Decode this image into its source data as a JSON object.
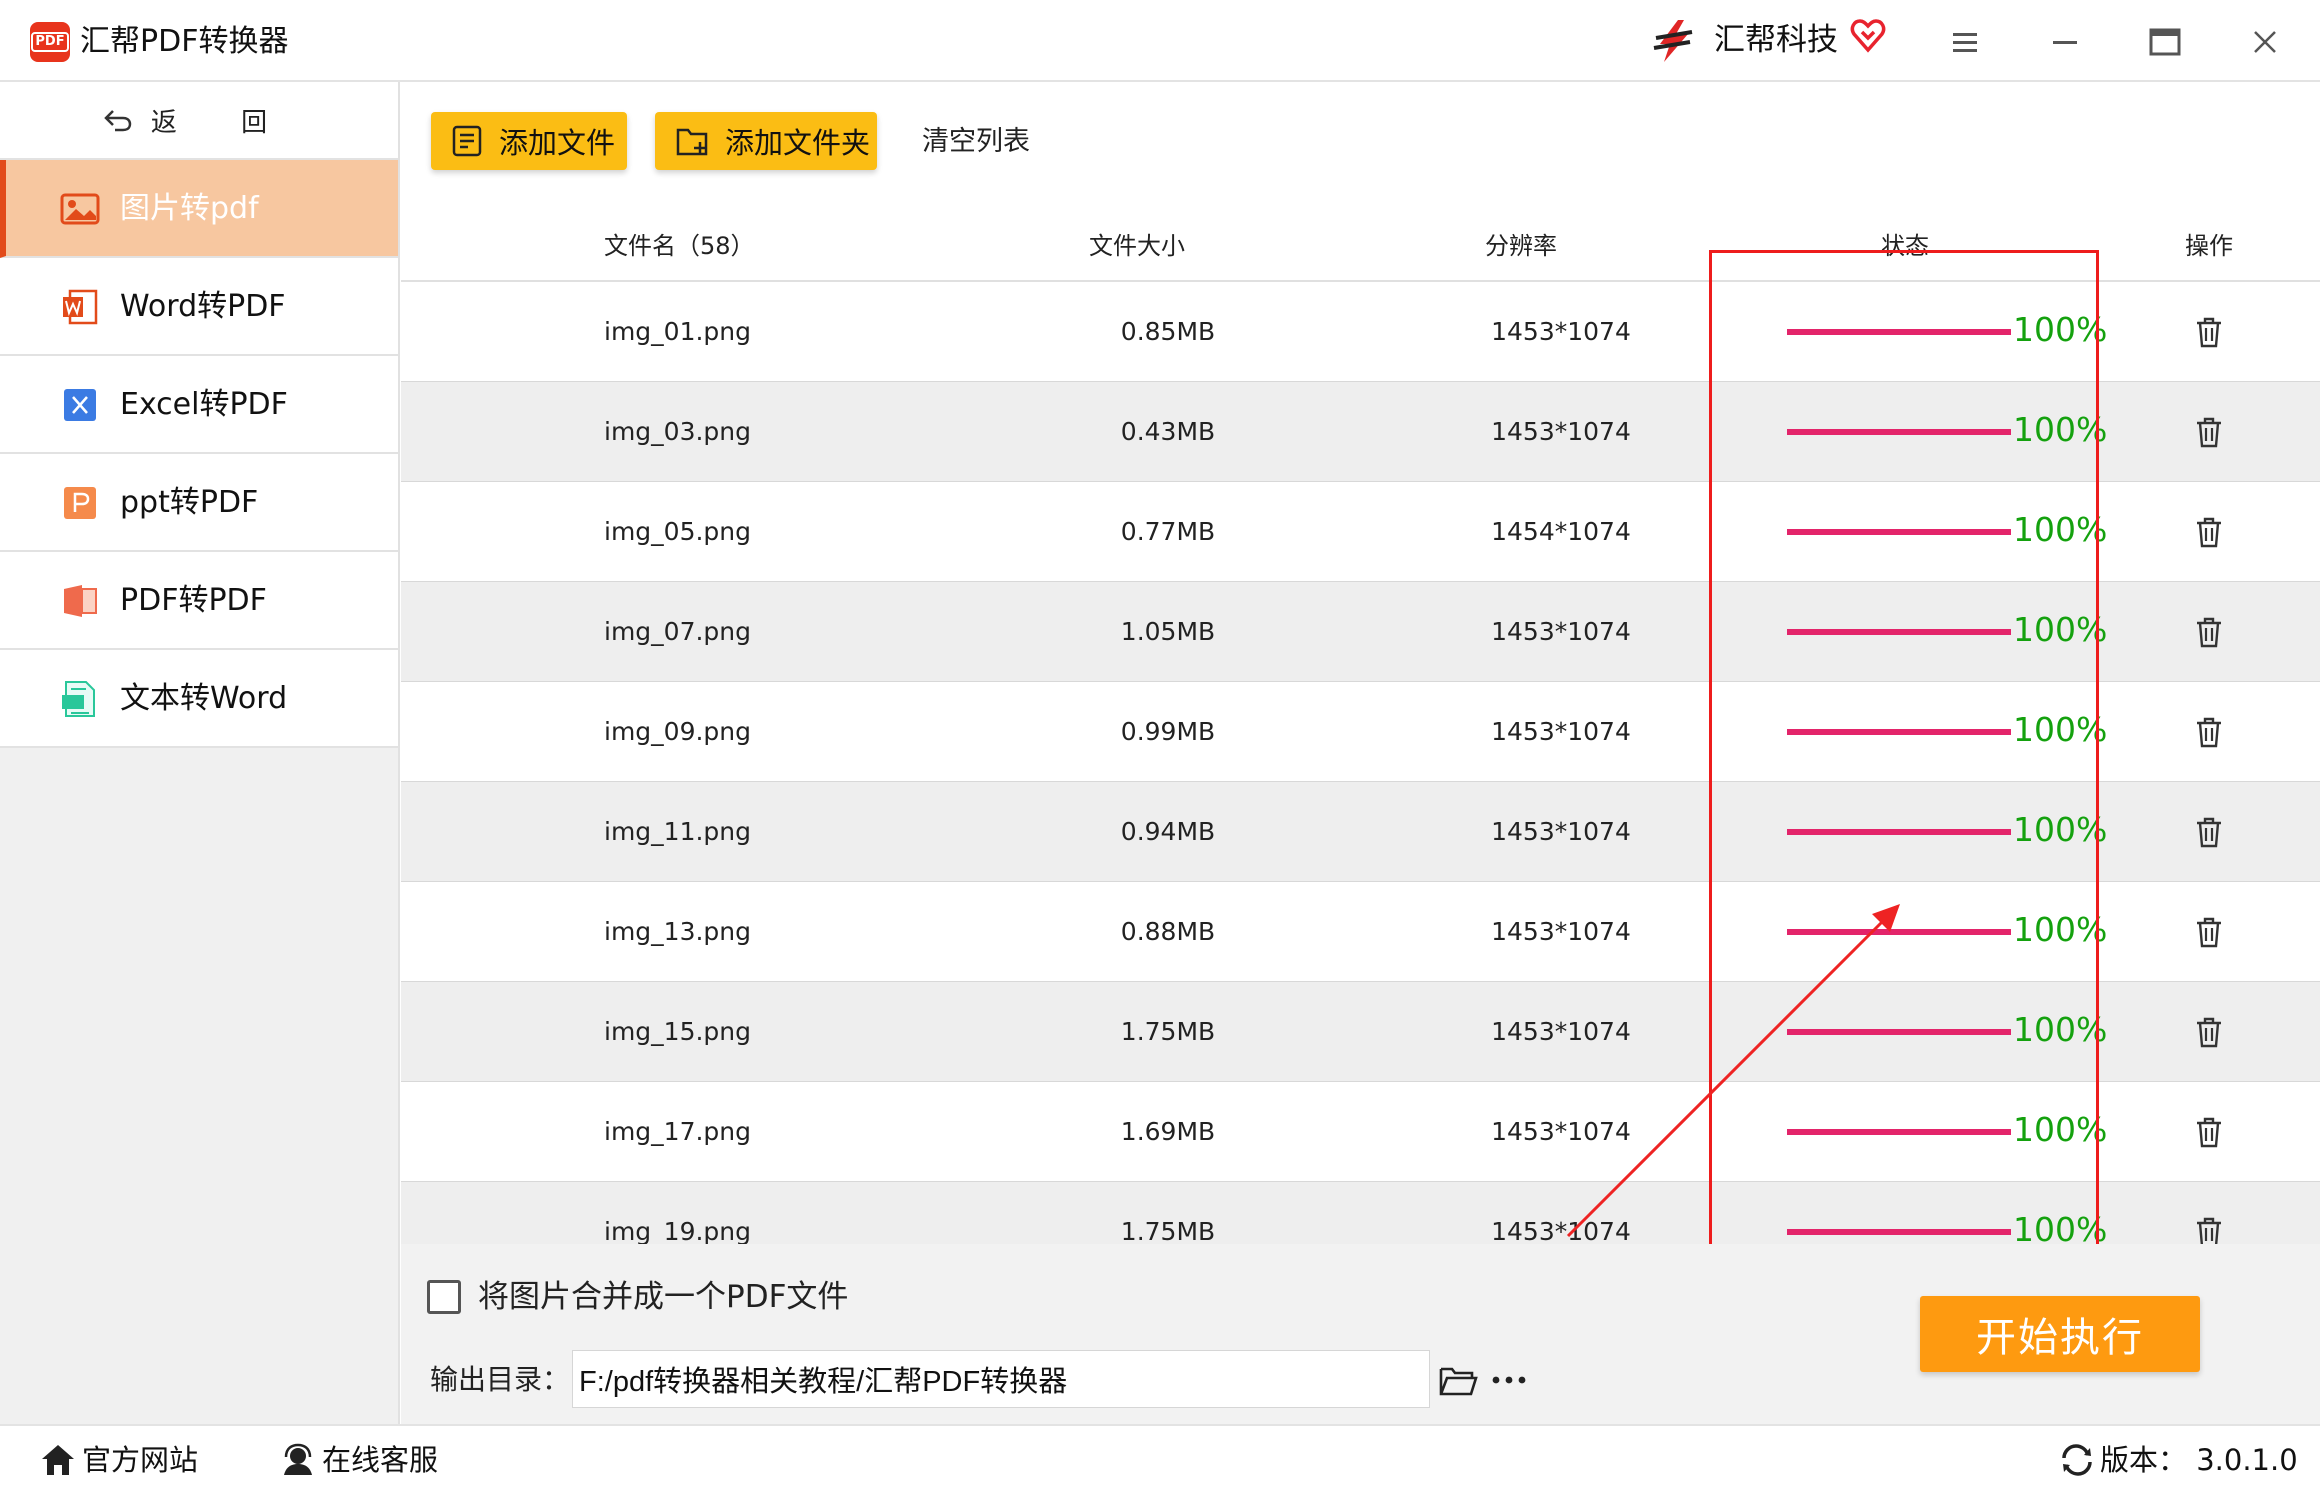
{
  "titlebar": {
    "app_icon_text": "PDF",
    "app_title": "汇帮PDF转换器",
    "brand_name": "汇帮科技",
    "icons": [
      "brand-logo-icon",
      "vip-heart-icon",
      "menu-icon",
      "minimize-icon",
      "maximize-icon",
      "close-icon"
    ]
  },
  "sidebar": {
    "back_label": "返 回",
    "items": [
      {
        "label": "图片转pdf",
        "icon": "image-icon",
        "active": true
      },
      {
        "label": "Word转PDF",
        "icon": "word-icon",
        "active": false
      },
      {
        "label": "Excel转PDF",
        "icon": "excel-icon",
        "active": false
      },
      {
        "label": "ppt转PDF",
        "icon": "ppt-icon",
        "active": false
      },
      {
        "label": "PDF转PDF",
        "icon": "pdf-icon",
        "active": false
      },
      {
        "label": "文本转Word",
        "icon": "text-doc-icon",
        "active": false
      }
    ]
  },
  "toolbar": {
    "add_file": "添加文件",
    "add_folder": "添加文件夹",
    "clear_list": "清空列表"
  },
  "table": {
    "headers": {
      "name": "文件名（58）",
      "size": "文件大小",
      "resolution": "分辨率",
      "status": "状态",
      "action": "操作"
    },
    "rows": [
      {
        "name": "img_01.png",
        "size": "0.85MB",
        "resolution": "1453*1074",
        "progress": "100%"
      },
      {
        "name": "img_03.png",
        "size": "0.43MB",
        "resolution": "1453*1074",
        "progress": "100%"
      },
      {
        "name": "img_05.png",
        "size": "0.77MB",
        "resolution": "1454*1074",
        "progress": "100%"
      },
      {
        "name": "img_07.png",
        "size": "1.05MB",
        "resolution": "1453*1074",
        "progress": "100%"
      },
      {
        "name": "img_09.png",
        "size": "0.99MB",
        "resolution": "1453*1074",
        "progress": "100%"
      },
      {
        "name": "img_11.png",
        "size": "0.94MB",
        "resolution": "1453*1074",
        "progress": "100%"
      },
      {
        "name": "img_13.png",
        "size": "0.88MB",
        "resolution": "1453*1074",
        "progress": "100%"
      },
      {
        "name": "img_15.png",
        "size": "1.75MB",
        "resolution": "1453*1074",
        "progress": "100%"
      },
      {
        "name": "img_17.png",
        "size": "1.69MB",
        "resolution": "1453*1074",
        "progress": "100%"
      },
      {
        "name": "img_19.png",
        "size": "1.75MB",
        "resolution": "1453*1074",
        "progress": "100%"
      }
    ]
  },
  "bottom": {
    "merge_label": "将图片合并成一个PDF文件",
    "merge_checked": false,
    "output_label": "输出目录：",
    "output_path": "F:/pdf转换器相关教程/汇帮PDF转换器",
    "start_button": "开始执行"
  },
  "statusbar": {
    "website": "官方网站",
    "support": "在线客服",
    "version": "版本： 3.0.1.0"
  },
  "colors": {
    "accent_yellow": "#fbbd14",
    "start_orange": "#fe9a10",
    "progress_pink": "#e3246a",
    "progress_text_green": "#14a10e",
    "sidebar_active": "#f7c7a0",
    "annotation_red": "#ee1c1c"
  }
}
